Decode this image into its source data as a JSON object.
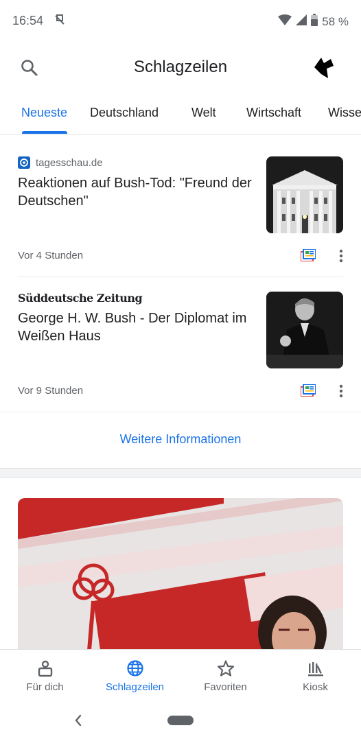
{
  "status_bar": {
    "time": "16:54",
    "battery": "58 %",
    "icons": [
      "notification-icon",
      "wifi-icon",
      "signal-icon",
      "battery-icon"
    ]
  },
  "app_bar": {
    "title": "Schlagzeilen",
    "search_icon": "search-icon",
    "avatar_icon": "dog-avatar"
  },
  "tabs": [
    {
      "label": "Neueste",
      "active": true
    },
    {
      "label": "Deutschland",
      "active": false
    },
    {
      "label": "Welt",
      "active": false
    },
    {
      "label": "Wirtschaft",
      "active": false
    },
    {
      "label": "Wisse",
      "active": false
    }
  ],
  "articles": [
    {
      "source": "tagesschau.de",
      "headline": "Reaktionen auf Bush-Tod: \"Freund der Deutschen\"",
      "time": "Vor 4 Stunden",
      "thumbnail": "white-house-photo"
    },
    {
      "source": "Süddeutsche Zeitung",
      "headline": "George H. W. Bush - Der Diplomat im Weißen Haus",
      "time": "Vor 9 Stunden",
      "thumbnail": "bush-portrait-photo"
    }
  ],
  "more_info": "Weitere Informationen",
  "hero": {
    "image": "jusos-banner-photo"
  },
  "bottom_nav": [
    {
      "label": "Für dich",
      "icon": "for-you-icon",
      "active": false
    },
    {
      "label": "Schlagzeilen",
      "icon": "globe-icon",
      "active": true
    },
    {
      "label": "Favoriten",
      "icon": "star-icon",
      "active": false
    },
    {
      "label": "Kiosk",
      "icon": "newsstand-icon",
      "active": false
    }
  ],
  "colors": {
    "accent": "#1a73e8",
    "text": "#202124",
    "secondary": "#5f6368"
  }
}
